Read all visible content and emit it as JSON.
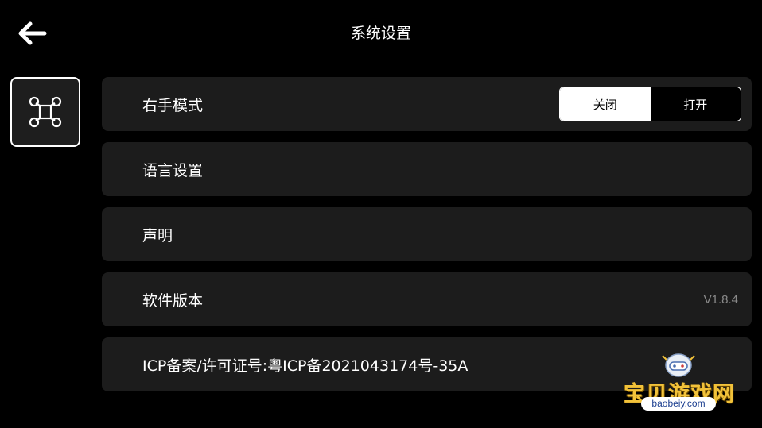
{
  "header": {
    "title": "系统设置"
  },
  "sidebar": {
    "active_tab_icon": "drone-icon"
  },
  "settings": {
    "right_hand_mode": {
      "label": "右手模式",
      "off_label": "关闭",
      "on_label": "打开",
      "selected": "关闭"
    },
    "language": {
      "label": "语言设置"
    },
    "statement": {
      "label": "声明"
    },
    "version": {
      "label": "软件版本",
      "value": "V1.8.4"
    },
    "icp": {
      "label": "ICP备案/许可证号:粤ICP备2021043174号-35A"
    }
  },
  "watermark": {
    "name": "宝贝游戏网",
    "url": "baobeiy.com"
  },
  "colors": {
    "background": "#000000",
    "row_bg": "#1c1c1c",
    "text": "#ffffff",
    "muted": "#8a8a8a",
    "watermark": "#f2c23a"
  }
}
